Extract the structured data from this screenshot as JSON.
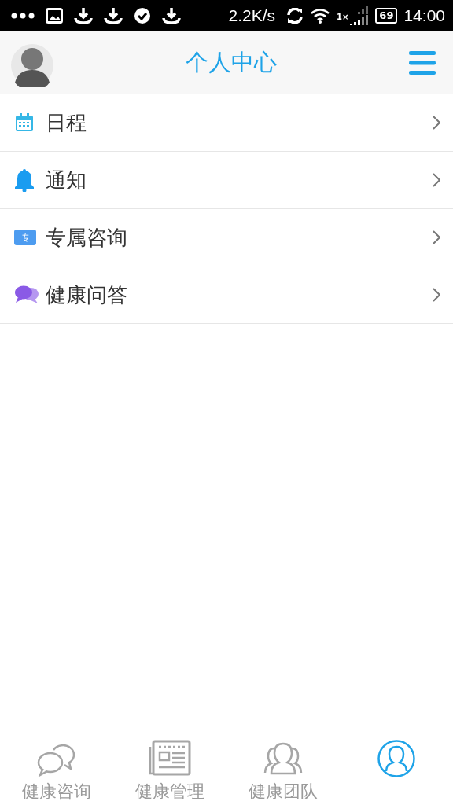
{
  "status_bar": {
    "speed": "2.2K/s",
    "sim": "1×",
    "battery": "69",
    "time": "14:00"
  },
  "header": {
    "title": "个人中心"
  },
  "menu": [
    {
      "kind": "calendar",
      "label": "日程"
    },
    {
      "kind": "bell",
      "label": "通知"
    },
    {
      "kind": "exclusive",
      "label": "专属咨询",
      "badge": "专"
    },
    {
      "kind": "chat",
      "label": "健康问答"
    }
  ],
  "tabs": [
    {
      "kind": "chat",
      "label": "健康咨询",
      "selected": false
    },
    {
      "kind": "news",
      "label": "健康管理",
      "selected": false
    },
    {
      "kind": "team",
      "label": "健康团队",
      "selected": false
    },
    {
      "kind": "user",
      "selected": true
    }
  ]
}
